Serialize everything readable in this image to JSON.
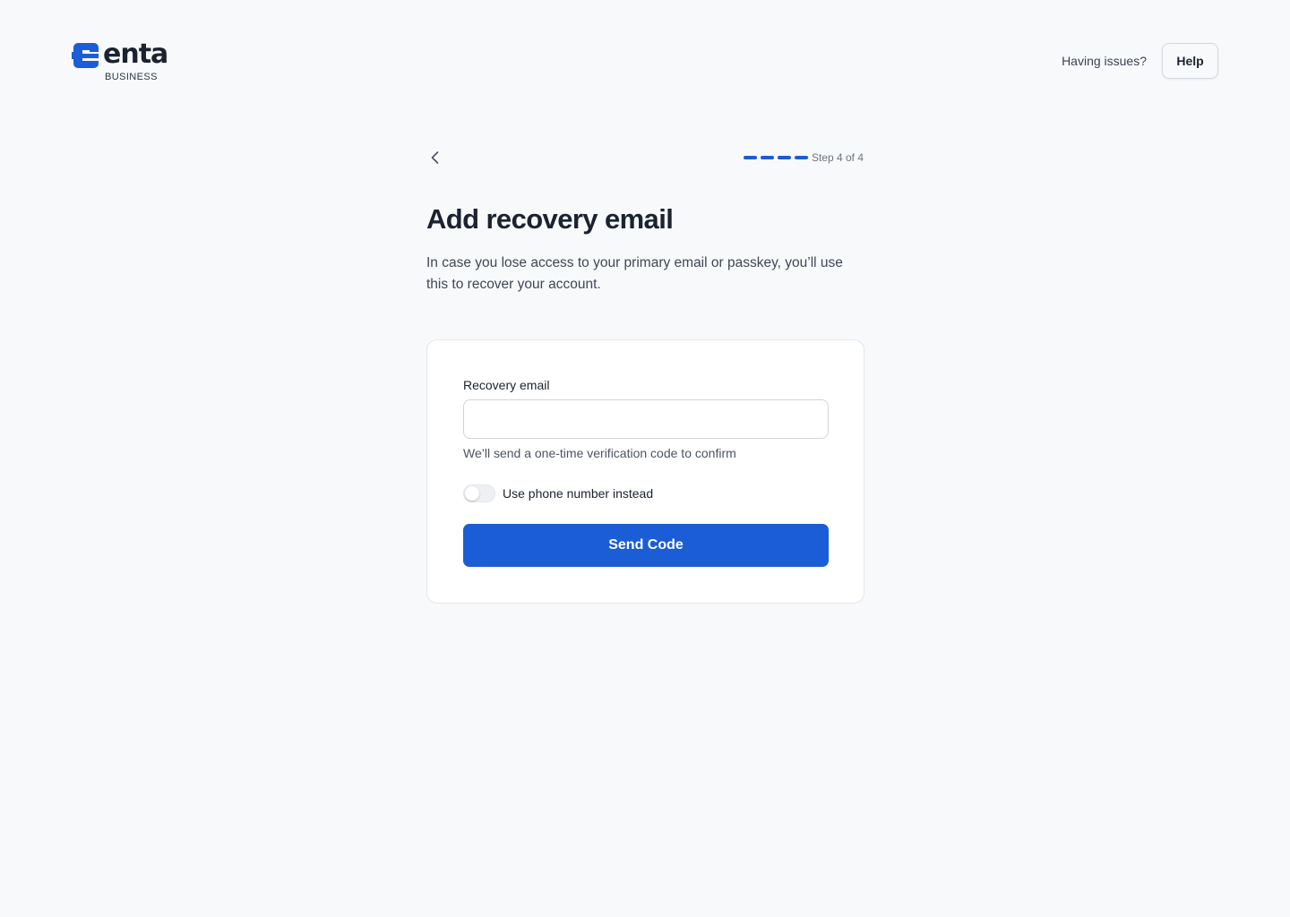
{
  "header": {
    "logo_word": "enta",
    "logo_subtitle": "BUSINESS",
    "issues_text": "Having issues?",
    "help_label": "Help"
  },
  "stepper": {
    "current_step": 4,
    "total_steps": 4,
    "step_text": "Step 4 of 4"
  },
  "main": {
    "title": "Add recovery email",
    "subtitle": "In case you lose access to your primary email or passkey, you’ll use this to recover your account."
  },
  "form": {
    "email_label": "Recovery email",
    "email_value": "",
    "email_placeholder": "",
    "helper_text": "We’ll send a one-time verification code to confirm",
    "toggle_label": "Use phone number instead",
    "toggle_on": false,
    "submit_label": "Send Code"
  },
  "colors": {
    "accent": "#1a5dd6",
    "text": "#1b2230",
    "background": "#f8f9fb"
  },
  "icons": {
    "back": "chevron-left-icon",
    "logo": "enta-logo-mark"
  }
}
